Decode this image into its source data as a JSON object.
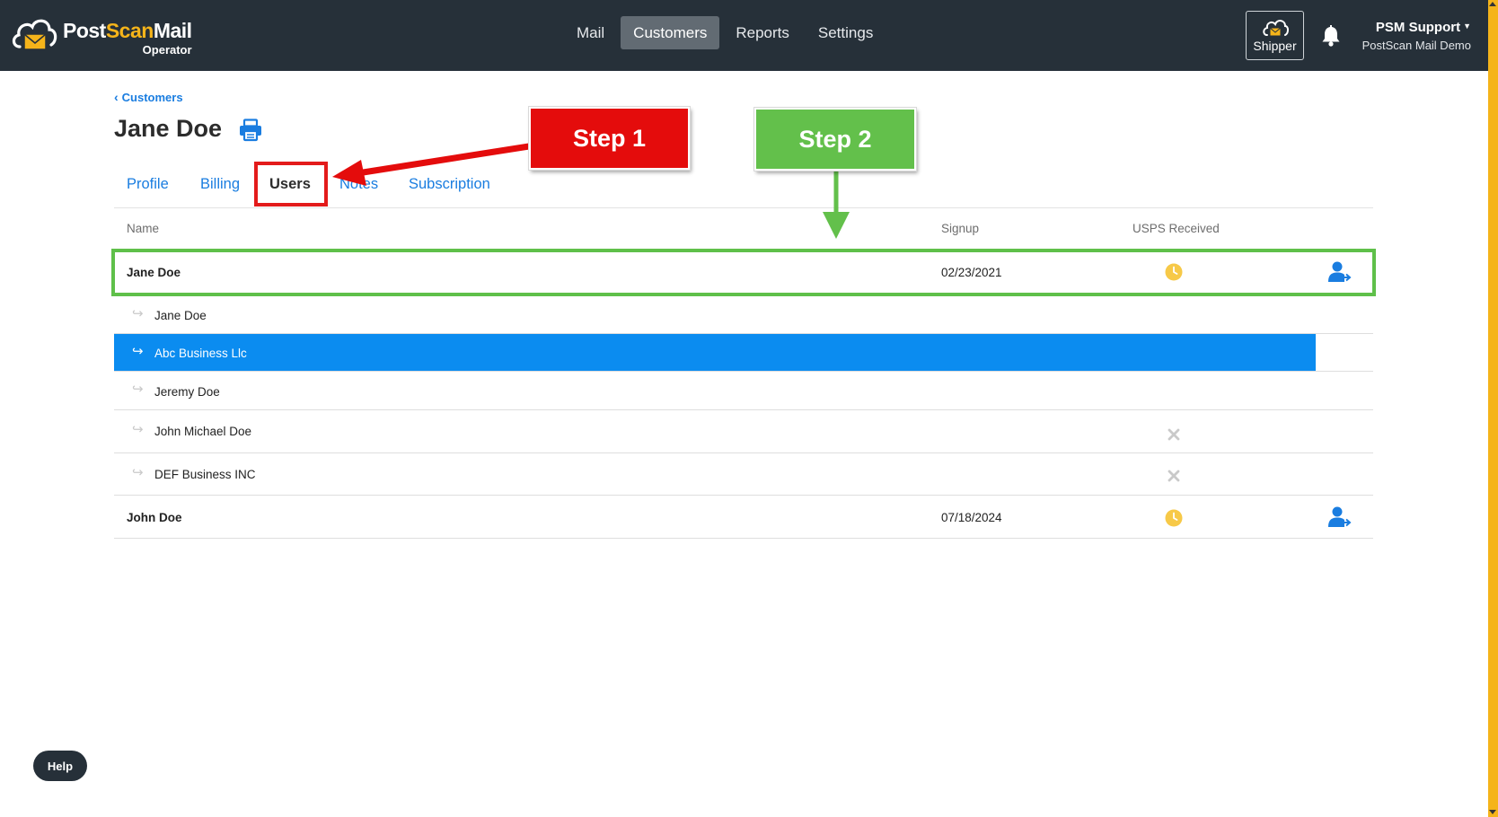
{
  "app": {
    "logo_name_part1": "Post",
    "logo_name_part2": "Scan",
    "logo_name_part3": "Mail",
    "logo_sub": "Operator"
  },
  "nav": {
    "items": [
      {
        "label": "Mail",
        "active": false
      },
      {
        "label": "Customers",
        "active": true
      },
      {
        "label": "Reports",
        "active": false
      },
      {
        "label": "Settings",
        "active": false
      }
    ]
  },
  "header": {
    "shipper_label": "Shipper",
    "account_name": "PSM Support",
    "account_org": "PostScan Mail Demo"
  },
  "breadcrumb": {
    "label": "Customers"
  },
  "page": {
    "title": "Jane Doe"
  },
  "tabs": [
    {
      "label": "Profile",
      "active": false
    },
    {
      "label": "Billing",
      "active": false
    },
    {
      "label": "Users",
      "active": true
    },
    {
      "label": "Notes",
      "active": false
    },
    {
      "label": "Subscription",
      "active": false
    }
  ],
  "table": {
    "columns": [
      "Name",
      "Signup",
      "USPS Received"
    ],
    "rows": [
      {
        "name": "Jane Doe",
        "type": "parent",
        "signup": "02/23/2021",
        "usps": "pending",
        "action": "login-as-user"
      },
      {
        "name": "Jane Doe",
        "type": "child",
        "signup": "",
        "usps": "",
        "action": ""
      },
      {
        "name": "Abc Business Llc",
        "type": "child",
        "selected": true,
        "signup": "",
        "usps": "",
        "action": ""
      },
      {
        "name": "Jeremy Doe",
        "type": "child",
        "signup": "",
        "usps": "",
        "action": ""
      },
      {
        "name": "John Michael Doe",
        "type": "child",
        "signup": "",
        "usps": "not-received",
        "action": ""
      },
      {
        "name": "DEF Business INC",
        "type": "child",
        "signup": "",
        "usps": "not-received",
        "action": ""
      },
      {
        "name": "John Doe",
        "type": "parent",
        "signup": "07/18/2024",
        "usps": "pending",
        "action": "login-as-user"
      }
    ]
  },
  "annotations": {
    "step1_label": "Step 1",
    "step2_label": "Step 2",
    "step1_color": "#e40c0c",
    "step2_color": "#63c04b"
  },
  "help": {
    "label": "Help"
  },
  "colors": {
    "header_bg": "#263039",
    "link": "#1a7de0",
    "selected_row": "#0b8cf0",
    "pending_clock": "#f7c948",
    "brand_accent": "#f5b41a"
  }
}
